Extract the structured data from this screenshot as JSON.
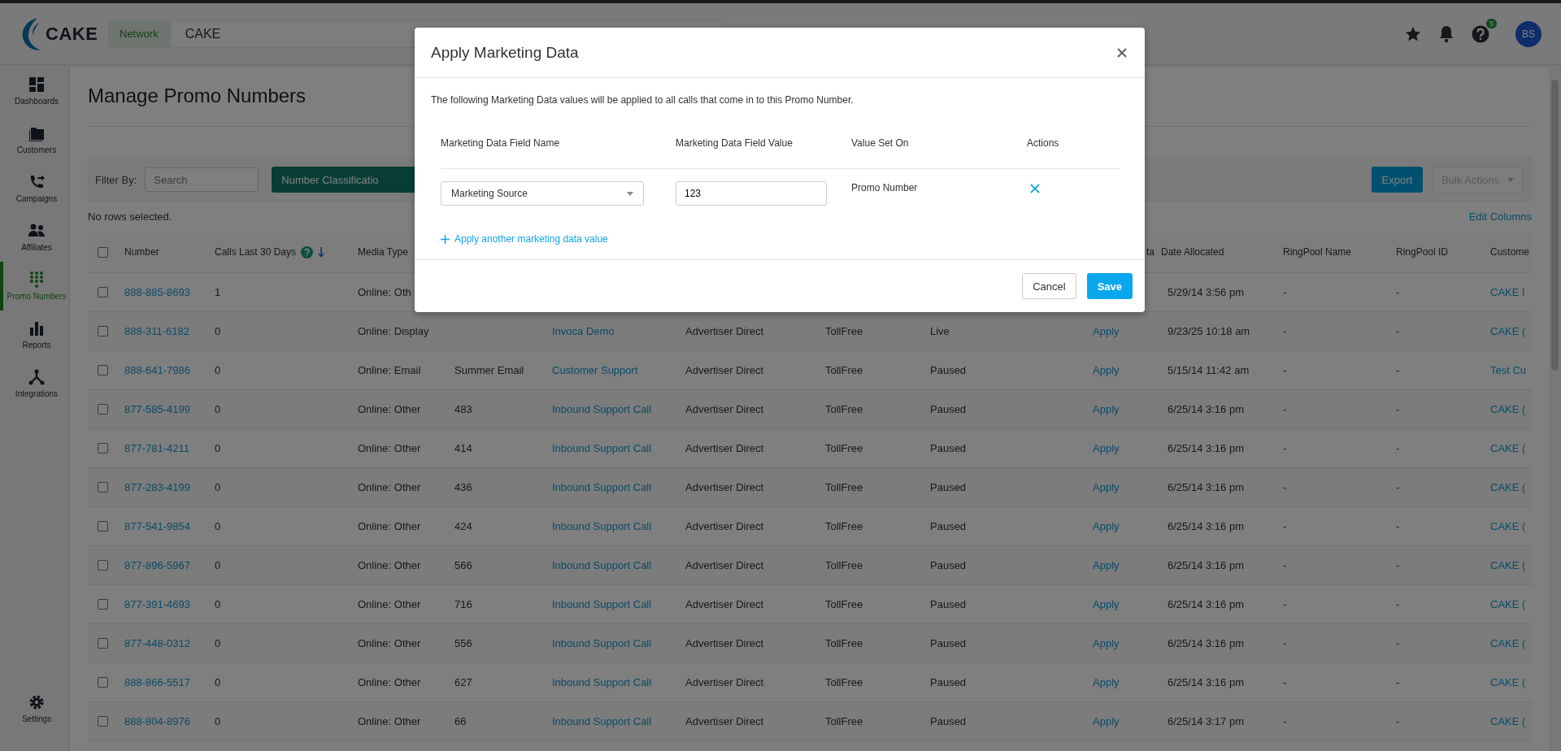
{
  "top_bar": {
    "logo": "CAKE",
    "scope_tag": "Network",
    "scope_value": "CAKE",
    "help_badge": "5",
    "avatar": "BS"
  },
  "sidebar": {
    "items": [
      {
        "label": "Dashboards",
        "kind": "dashboards",
        "selected": false
      },
      {
        "label": "Customers",
        "kind": "customers",
        "selected": false
      },
      {
        "label": "Campaigns",
        "kind": "campaigns",
        "selected": false
      },
      {
        "label": "Affiliates",
        "kind": "affiliates",
        "selected": false
      },
      {
        "label": "Promo Numbers",
        "kind": "promo_numbers",
        "selected": true
      },
      {
        "label": "Reports",
        "kind": "reports",
        "selected": false
      },
      {
        "label": "Integrations",
        "kind": "integrations",
        "selected": false
      }
    ],
    "bottom_item": {
      "label": "Settings",
      "kind": "settings",
      "selected": false
    }
  },
  "page": {
    "title": "Manage Promo Numbers",
    "filter_label": "Filter By:",
    "search": {
      "placeholder": "Search"
    },
    "classification_button": "Number Classificatio",
    "export_button": "Export",
    "bulk_actions": {
      "label": "Bulk Actions",
      "disabled": true
    },
    "selection_status": "No rows selected.",
    "edit_columns": "Edit Columns"
  },
  "table": {
    "all_checked": false,
    "calls_sorted_descending": true,
    "header": {
      "number": "Number",
      "calls": "Calls Last 30 Days",
      "media_type": "Media Type",
      "column_9": "ta",
      "date_allocated": "Date Allocated",
      "ringpool_name": "RingPool Name",
      "ringpool_id": "RingPool ID",
      "customer": "Custome"
    },
    "rows": [
      {
        "checked": false,
        "number": "888-885-8693",
        "calls": "1",
        "media_type": "Online: Oth",
        "date_allocated": "5/29/14 3:56 pm",
        "ringpool_name": "-",
        "ringpool_id": "-",
        "customer": "CAKE I"
      },
      {
        "checked": false,
        "number": "888-311-6182",
        "calls": "0",
        "media_type": "Online: Display",
        "column_5": "Invoca Demo",
        "column_6": "Advertiser Direct",
        "column_7": "TollFree",
        "column_8": "Live",
        "column_9": "Apply",
        "date_allocated": "9/23/25 10:18 am",
        "ringpool_name": "-",
        "ringpool_id": "-",
        "customer": "CAKE ("
      },
      {
        "checked": false,
        "number": "888-641-7986",
        "calls": "0",
        "media_type": "Online: Email",
        "column_4": "Summer Email",
        "column_5": "Customer Support",
        "column_6": "Advertiser Direct",
        "column_7": "TollFree",
        "column_8": "Paused",
        "column_9": "Apply",
        "date_allocated": "5/15/14 11:42 am",
        "ringpool_name": "-",
        "ringpool_id": "-",
        "customer": "Test Cu"
      },
      {
        "checked": false,
        "number": "877-585-4199",
        "calls": "0",
        "media_type": "Online: Other",
        "column_4": "483",
        "column_5": "Inbound Support Call",
        "column_6": "Advertiser Direct",
        "column_7": "TollFree",
        "column_8": "Paused",
        "column_9": "Apply",
        "date_allocated": "6/25/14 3:16 pm",
        "ringpool_name": "-",
        "ringpool_id": "-",
        "customer": "CAKE ("
      },
      {
        "checked": false,
        "number": "877-781-4211",
        "calls": "0",
        "media_type": "Online: Other",
        "column_4": "414",
        "column_5": "Inbound Support Call",
        "column_6": "Advertiser Direct",
        "column_7": "TollFree",
        "column_8": "Paused",
        "column_9": "Apply",
        "date_allocated": "6/25/14 3:16 pm",
        "ringpool_name": "-",
        "ringpool_id": "-",
        "customer": "CAKE ("
      },
      {
        "checked": false,
        "number": "877-283-4199",
        "calls": "0",
        "media_type": "Online: Other",
        "column_4": "436",
        "column_5": "Inbound Support Call",
        "column_6": "Advertiser Direct",
        "column_7": "TollFree",
        "column_8": "Paused",
        "column_9": "Apply",
        "date_allocated": "6/25/14 3:16 pm",
        "ringpool_name": "-",
        "ringpool_id": "-",
        "customer": "CAKE ("
      },
      {
        "checked": false,
        "number": "877-541-9854",
        "calls": "0",
        "media_type": "Online: Other",
        "column_4": "424",
        "column_5": "Inbound Support Call",
        "column_6": "Advertiser Direct",
        "column_7": "TollFree",
        "column_8": "Paused",
        "column_9": "Apply",
        "date_allocated": "6/25/14 3:16 pm",
        "ringpool_name": "-",
        "ringpool_id": "-",
        "customer": "CAKE ("
      },
      {
        "checked": false,
        "number": "877-896-5967",
        "calls": "0",
        "media_type": "Online: Other",
        "column_4": "566",
        "column_5": "Inbound Support Call",
        "column_6": "Advertiser Direct",
        "column_7": "TollFree",
        "column_8": "Paused",
        "column_9": "Apply",
        "date_allocated": "6/25/14 3:16 pm",
        "ringpool_name": "-",
        "ringpool_id": "-",
        "customer": "CAKE ("
      },
      {
        "checked": false,
        "number": "877-391-4693",
        "calls": "0",
        "media_type": "Online: Other",
        "column_4": "716",
        "column_5": "Inbound Support Call",
        "column_6": "Advertiser Direct",
        "column_7": "TollFree",
        "column_8": "Paused",
        "column_9": "Apply",
        "date_allocated": "6/25/14 3:16 pm",
        "ringpool_name": "-",
        "ringpool_id": "-",
        "customer": "CAKE ("
      },
      {
        "checked": false,
        "number": "877-448-0312",
        "calls": "0",
        "media_type": "Online: Other",
        "column_4": "556",
        "column_5": "Inbound Support Call",
        "column_6": "Advertiser Direct",
        "column_7": "TollFree",
        "column_8": "Paused",
        "column_9": "Apply",
        "date_allocated": "6/25/14 3:16 pm",
        "ringpool_name": "-",
        "ringpool_id": "-",
        "customer": "CAKE ("
      },
      {
        "checked": false,
        "number": "888-866-5517",
        "calls": "0",
        "media_type": "Online: Other",
        "column_4": "627",
        "column_5": "Inbound Support Call",
        "column_6": "Advertiser Direct",
        "column_7": "TollFree",
        "column_8": "Paused",
        "column_9": "Apply",
        "date_allocated": "6/25/14 3:16 pm",
        "ringpool_name": "-",
        "ringpool_id": "-",
        "customer": "CAKE ("
      },
      {
        "checked": false,
        "number": "888-804-8976",
        "calls": "0",
        "media_type": "Online: Other",
        "column_4": "66",
        "column_5": "Inbound Support Call",
        "column_6": "Advertiser Direct",
        "column_7": "TollFree",
        "column_8": "Paused",
        "column_9": "Apply",
        "date_allocated": "6/25/14 3:17 pm",
        "ringpool_name": "-",
        "ringpool_id": "-",
        "customer": "CAKE ("
      }
    ]
  },
  "modal": {
    "title": "Apply Marketing Data",
    "description": "The following Marketing Data values will be applied to all calls that come in to this Promo Number.",
    "columns": [
      "Marketing Data Field Name",
      "Marketing Data Field Value",
      "Value Set On",
      "Actions"
    ],
    "rows": [
      {
        "field_name": "Marketing Source",
        "field_value": "123",
        "value_set_on": "Promo Number"
      }
    ],
    "add_link": "Apply another marketing data value",
    "cancel_button": "Cancel",
    "save_button": "Save"
  }
}
